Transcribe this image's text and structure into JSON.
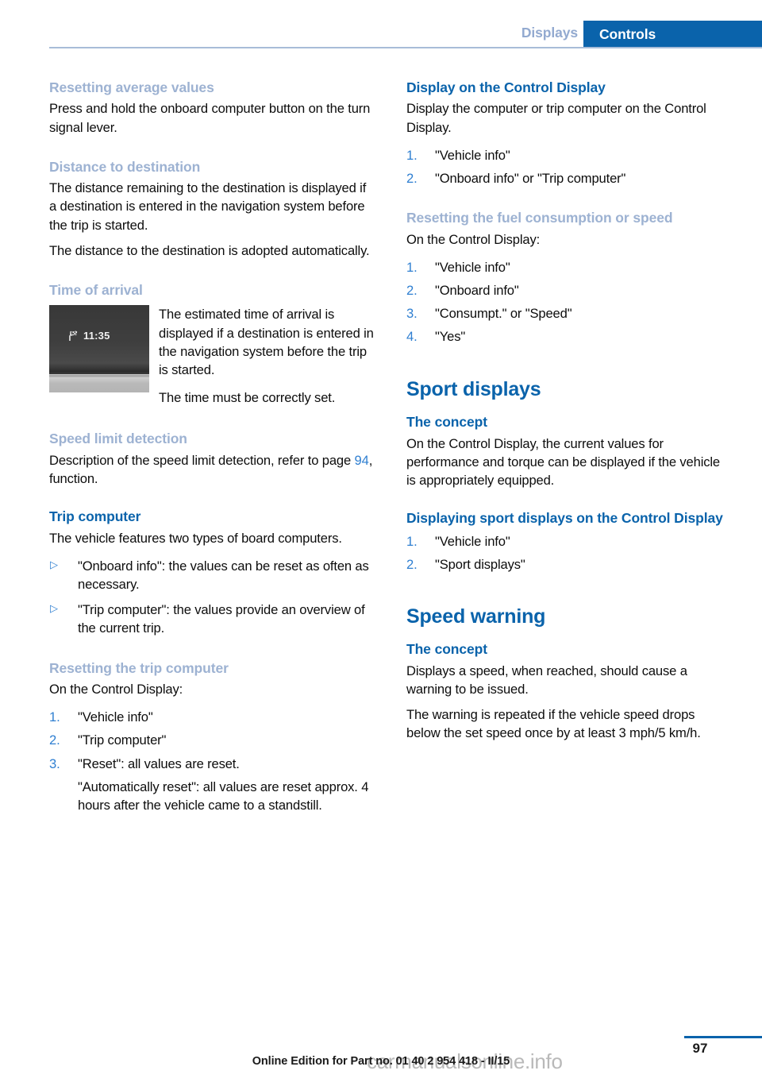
{
  "header": {
    "tab_inactive": "Displays",
    "tab_active": "Controls",
    "accent_active": "#0a63ab",
    "accent_inactive": "#93aad0"
  },
  "left_column": {
    "sections": [
      {
        "heading": "Resetting average values",
        "heading_level": "h4",
        "paragraphs": [
          "Press and hold the onboard computer button on the turn signal lever."
        ]
      },
      {
        "heading": "Distance to destination",
        "heading_level": "h4",
        "paragraphs": [
          "The distance remaining to the destination is displayed if a destination is entered in the navigation system before the trip is started.",
          "The distance to the destination is adopted automatically."
        ]
      },
      {
        "heading": "Time of arrival",
        "heading_level": "h4",
        "figure": {
          "icon": "checkered-flag-icon",
          "time_value": "11:35"
        },
        "paragraphs": [
          "The estimated time of arrival is displayed if a destination is entered in the navigation system before the trip is started.",
          "The time must be correctly set."
        ]
      },
      {
        "heading": "Speed limit detection",
        "heading_level": "h4",
        "paragraph_before_ref": "Description of the speed limit detection, refer to page ",
        "page_ref": "94",
        "paragraph_after_ref": ", function."
      },
      {
        "heading": "Trip computer",
        "heading_level": "h3",
        "paragraphs": [
          "The vehicle features two types of board computers."
        ],
        "bullets": [
          "\"Onboard info\": the values can be reset as often as necessary.",
          "\"Trip computer\": the values provide an overview of the current trip."
        ]
      },
      {
        "heading": "Resetting the trip computer",
        "heading_level": "h4",
        "paragraphs": [
          "On the Control Display:"
        ],
        "steps": [
          {
            "num": "1.",
            "text": "\"Vehicle info\""
          },
          {
            "num": "2.",
            "text": "\"Trip computer\""
          },
          {
            "num": "3.",
            "text": "\"Reset\": all values are reset.",
            "sub": "\"Automatically reset\": all values are reset approx. 4 hours after the vehicle came to a standstill."
          }
        ]
      }
    ]
  },
  "right_column": {
    "sections": [
      {
        "heading": "Display on the Control Display",
        "heading_level": "h3",
        "paragraphs": [
          "Display the computer or trip computer on the Control Display."
        ],
        "steps": [
          {
            "num": "1.",
            "text": "\"Vehicle info\""
          },
          {
            "num": "2.",
            "text": "\"Onboard info\" or \"Trip computer\""
          }
        ]
      },
      {
        "heading": "Resetting the fuel consumption or speed",
        "heading_level": "h4",
        "paragraphs": [
          "On the Control Display:"
        ],
        "steps": [
          {
            "num": "1.",
            "text": "\"Vehicle info\""
          },
          {
            "num": "2.",
            "text": "\"Onboard info\""
          },
          {
            "num": "3.",
            "text": "\"Consumpt.\" or \"Speed\""
          },
          {
            "num": "4.",
            "text": "\"Yes\""
          }
        ]
      },
      {
        "heading": "Sport displays",
        "heading_level": "h2"
      },
      {
        "heading": "The concept",
        "heading_level": "h3",
        "paragraphs": [
          "On the Control Display, the current values for performance and torque can be displayed if the vehicle is appropriately equipped."
        ]
      },
      {
        "heading": "Displaying sport displays on the Control Display",
        "heading_level": "h3",
        "steps": [
          {
            "num": "1.",
            "text": "\"Vehicle info\""
          },
          {
            "num": "2.",
            "text": "\"Sport displays\""
          }
        ]
      },
      {
        "heading": "Speed warning",
        "heading_level": "h2"
      },
      {
        "heading": "The concept",
        "heading_level": "h3",
        "paragraphs": [
          "Displays a speed, when reached, should cause a warning to be issued.",
          "The warning is repeated if the vehicle speed drops below the set speed once by at least 3 mph/5 km/h."
        ]
      }
    ]
  },
  "footer": {
    "edition_text": "Online Edition for Part no. 01 40 2 954 418 - II/15",
    "page_number": "97",
    "watermark": "carmanualsonline.info"
  }
}
